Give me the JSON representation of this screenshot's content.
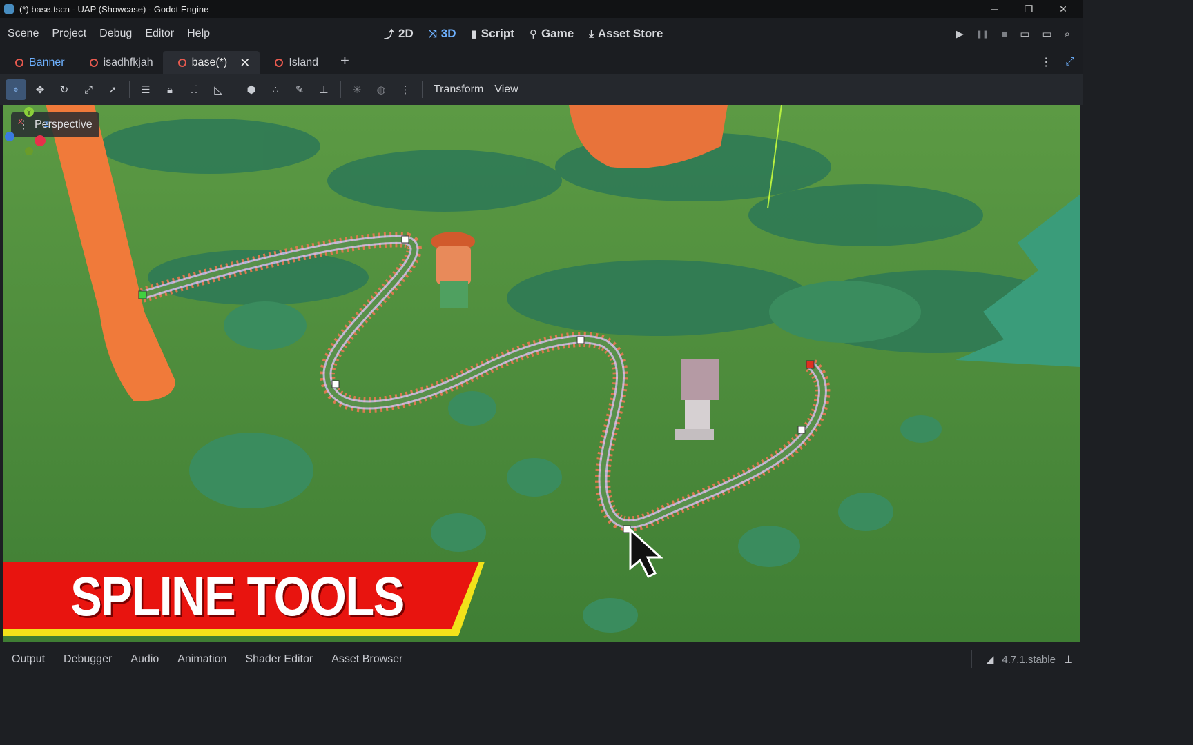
{
  "window": {
    "title": "(*) base.tscn - UAP (Showcase) - Godot Engine",
    "controls": {
      "minimize": "─",
      "restore": "❐",
      "close": "✕"
    }
  },
  "menubar": {
    "items": [
      "Scene",
      "Project",
      "Debug",
      "Editor",
      "Help"
    ],
    "workspaces": [
      {
        "label": "2D",
        "icon": "2d-icon"
      },
      {
        "label": "3D",
        "icon": "3d-icon",
        "active": true
      },
      {
        "label": "Script",
        "icon": "script-icon"
      },
      {
        "label": "Game",
        "icon": "game-icon"
      },
      {
        "label": "Asset Store",
        "icon": "asset-store-icon"
      }
    ],
    "run": {
      "play": "▶",
      "pause": "❚❚",
      "stop": "■",
      "movie": "🎞",
      "remote": "🎬",
      "search": "⌕"
    }
  },
  "scene_tabs": [
    {
      "label": "Banner",
      "linked": true
    },
    {
      "label": "isadhfkjah"
    },
    {
      "label": "base(*)",
      "active": true,
      "close": "✕"
    },
    {
      "label": "Island"
    }
  ],
  "scene_tabs_extra": {
    "add": "+",
    "menu": "⋮",
    "distraction_free": "⤢"
  },
  "toolbar": {
    "tools": [
      "select-mode-icon",
      "move-mode-icon",
      "rotate-mode-icon",
      "scale-mode-icon",
      "list-select-icon",
      "group-icon",
      "lock-icon",
      "snap-icon",
      "ruler-icon",
      "local-space-icon",
      "use-snap-icon",
      "paint-icon",
      "pin-icon",
      "sun-icon",
      "environment-icon",
      "more-icon"
    ],
    "menus": [
      "Transform",
      "View"
    ]
  },
  "viewport": {
    "mode_label": "Perspective",
    "gizmo_axes": {
      "x": "X",
      "y": "Y",
      "z": "Z"
    },
    "banner_text": "SPLINE TOOLS"
  },
  "bottom_panels": [
    "Output",
    "Debugger",
    "Audio",
    "Animation",
    "Shader Editor",
    "Asset Browser"
  ],
  "version": "4.7.1.stable",
  "colors": {
    "accent": "#6eb1ff",
    "ground": "#4d8c3c",
    "banner_red": "#e8140f",
    "banner_yellow": "#f2e21a",
    "rail": "#e07a50",
    "spline": "#c8b6ff"
  }
}
